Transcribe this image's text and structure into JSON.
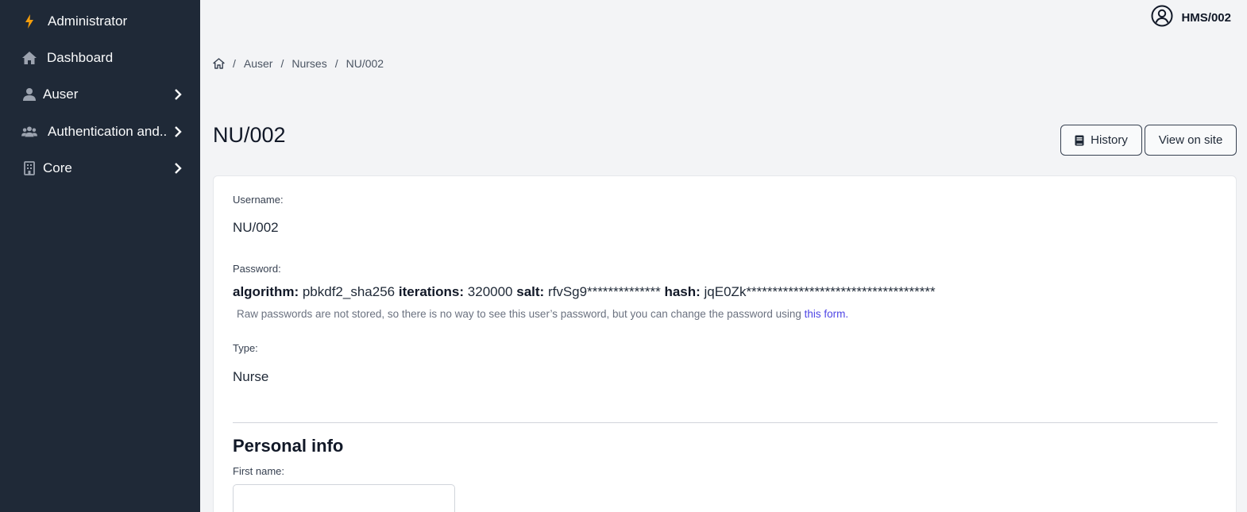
{
  "sidebar": {
    "items": [
      {
        "label": "Administrator",
        "icon": "bolt-icon"
      },
      {
        "label": "Dashboard",
        "icon": "home-icon"
      },
      {
        "label": "Auser",
        "icon": "user-icon"
      },
      {
        "label": "Authentication and..",
        "icon": "users-icon"
      },
      {
        "label": "Core",
        "icon": "building-icon"
      }
    ]
  },
  "topbar": {
    "username": "HMS/002",
    "icon": "user-circle-icon"
  },
  "breadcrumb": {
    "items": [
      "Auser",
      "Nurses",
      "NU/002"
    ],
    "separator": "/"
  },
  "page": {
    "title": "NU/002"
  },
  "actions": {
    "history_label": "History",
    "view_on_site_label": "View on site"
  },
  "form": {
    "username_label": "Username:",
    "username_value": "NU/002",
    "password_label": "Password:",
    "password": {
      "algorithm_key": "algorithm:",
      "algorithm_value": "pbkdf2_sha256",
      "iterations_key": "iterations:",
      "iterations_value": "320000",
      "salt_key": "salt:",
      "salt_value": "rfvSg9**************",
      "hash_key": "hash:",
      "hash_value": "jqE0Zk************************************"
    },
    "password_help": "Raw passwords are not stored, so there is no way to see this user’s password, but you can change the password using",
    "password_help_link": "this form.",
    "type_label": "Type:",
    "type_value": "Nurse",
    "section_title": "Personal info",
    "first_name_label": "First name:",
    "first_name_value": ""
  },
  "colors": {
    "sidebar_bg": "#1f2937",
    "page_bg": "#f3f4f6",
    "link": "#4f46e5",
    "bolt": "#f59e0b"
  }
}
